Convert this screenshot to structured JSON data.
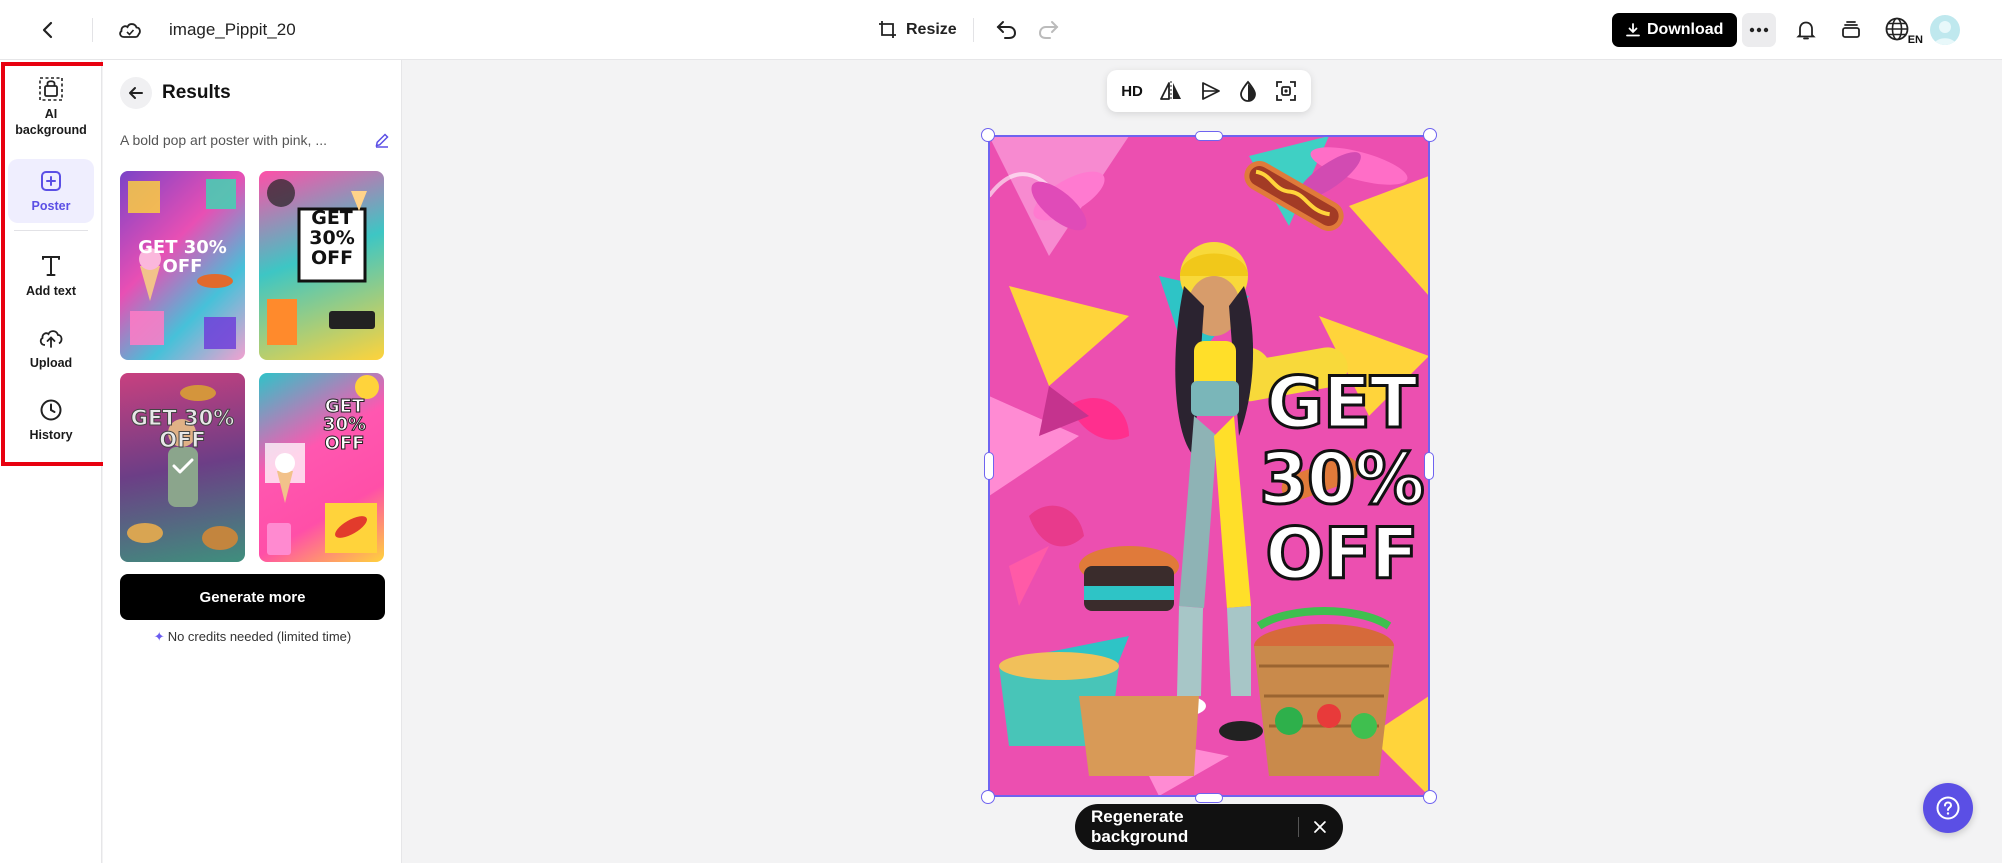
{
  "header": {
    "file_title": "image_Pippit_20",
    "resize_label": "Resize",
    "download_label": "Download",
    "language_code": "EN"
  },
  "rail": {
    "items": [
      {
        "label": "AI background",
        "icon": "ai-background-icon"
      },
      {
        "label": "Poster",
        "icon": "poster-icon",
        "active": true
      },
      {
        "label": "Add text",
        "icon": "text-icon"
      },
      {
        "label": "Upload",
        "icon": "upload-cloud-icon"
      },
      {
        "label": "History",
        "icon": "clock-icon"
      }
    ]
  },
  "results": {
    "title": "Results",
    "prompt": "A bold pop art poster with pink, ...",
    "thumbnails": [
      {
        "text": "GET 30% OFF"
      },
      {
        "text": "GET 30% OFF"
      },
      {
        "text": "GET 30% OFF",
        "selected": true
      },
      {
        "text": "GET 30% OFF"
      }
    ],
    "generate_more_label": "Generate more",
    "credits_note": "No credits needed (limited time)"
  },
  "canvas": {
    "toolbar": {
      "hd_label": "HD"
    },
    "poster_text": "GET 30% OFF",
    "regenerate_label": "Regenerate background"
  },
  "colors": {
    "accent": "#5b4fe5",
    "selection": "#6f63f0",
    "highlight": "#e8000f",
    "poster_pink": "#ec4fb0"
  }
}
